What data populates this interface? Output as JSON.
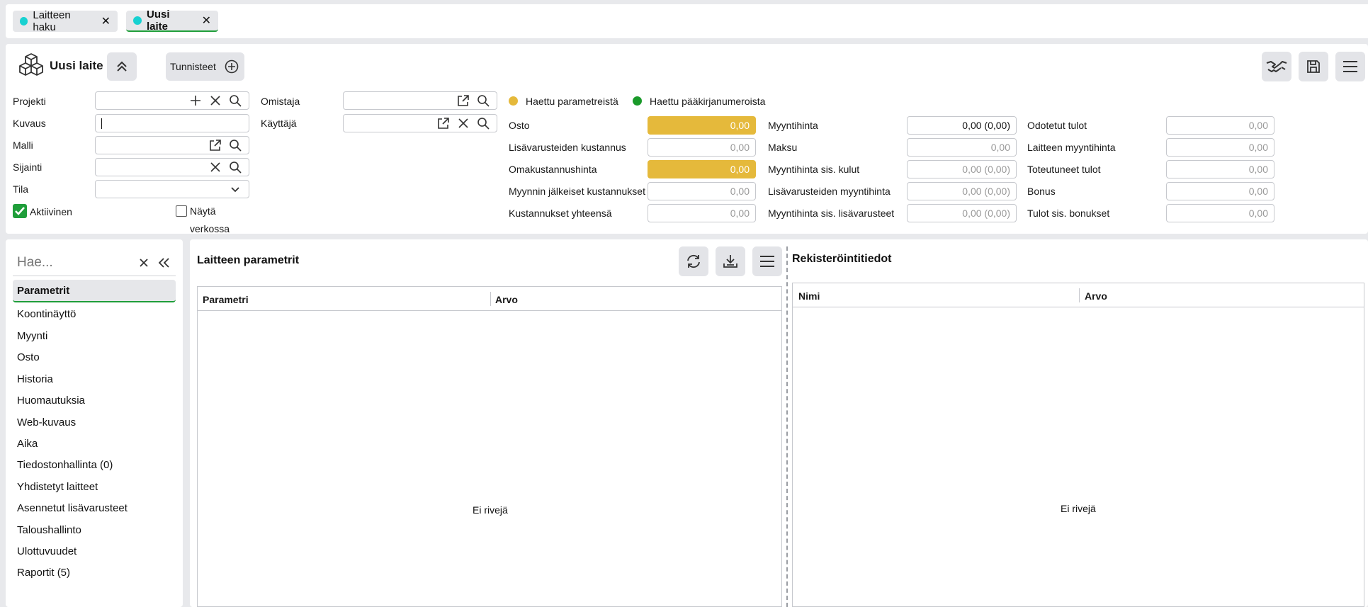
{
  "tabs": [
    {
      "label": "Laitteen haku"
    },
    {
      "label": "Uusi laite"
    }
  ],
  "header": {
    "title": "Uusi laite",
    "tunnisteet_label": "Tunnisteet"
  },
  "form": {
    "projekti": "Projekti",
    "kuvaus": "Kuvaus",
    "malli": "Malli",
    "sijainti": "Sijainti",
    "tila": "Tila",
    "aktiivinen": "Aktiivinen",
    "nayta_verkossa_1": "Näytä",
    "nayta_verkossa_2": "verkossa",
    "omistaja": "Omistaja",
    "kayttaja": "Käyttäjä"
  },
  "legend": {
    "params": "Haettu parametreistä",
    "ledger": "Haettu pääkirjanumeroista",
    "params_color": "#e5b93b",
    "ledger_color": "#1a9a2a"
  },
  "costs": {
    "col1": [
      {
        "label": "Osto",
        "value": "0,00"
      },
      {
        "label": "Lisävarusteiden kustannus",
        "value": "0,00"
      },
      {
        "label": "Omakustannushinta",
        "value": "0,00"
      },
      {
        "label": "Myynnin jälkeiset kustannukset",
        "value": "0,00"
      },
      {
        "label": "Kustannukset yhteensä",
        "value": "0,00"
      }
    ],
    "col2": [
      {
        "label": "Myyntihinta",
        "value": "0,00 (0,00)"
      },
      {
        "label": "Maksu",
        "value": "0,00"
      },
      {
        "label": "Myyntihinta sis. kulut",
        "value": "0,00 (0,00)"
      },
      {
        "label": "Lisävarusteiden myyntihinta",
        "value": "0,00 (0,00)"
      },
      {
        "label": "Myyntihinta sis. lisävarusteet",
        "value": "0,00 (0,00)"
      }
    ],
    "col3": [
      {
        "label": "Odotetut tulot",
        "value": "0,00"
      },
      {
        "label": "Laitteen myyntihinta",
        "value": "0,00"
      },
      {
        "label": "Toteutuneet tulot",
        "value": "0,00"
      },
      {
        "label": "Bonus",
        "value": "0,00"
      },
      {
        "label": "Tulot sis. bonukset",
        "value": "0,00"
      }
    ]
  },
  "nav": {
    "search_placeholder": "Hae...",
    "items": [
      "Parametrit",
      "Koontinäyttö",
      "Myynti",
      "Osto",
      "Historia",
      "Huomautuksia",
      "Web-kuvaus",
      "Aika",
      "Tiedostonhallinta (0)",
      "Yhdistetyt laitteet",
      "Asennetut lisävarusteet",
      "Taloushallinto",
      "Ulottuvuudet",
      "Raportit (5)"
    ]
  },
  "params_panel": {
    "title": "Laitteen parametrit",
    "col_param": "Parametri",
    "col_value": "Arvo",
    "empty": "Ei rivejä"
  },
  "reg_panel": {
    "title": "Rekisteröintitiedot",
    "col_name": "Nimi",
    "col_value": "Arvo",
    "empty": "Ei rivejä"
  }
}
